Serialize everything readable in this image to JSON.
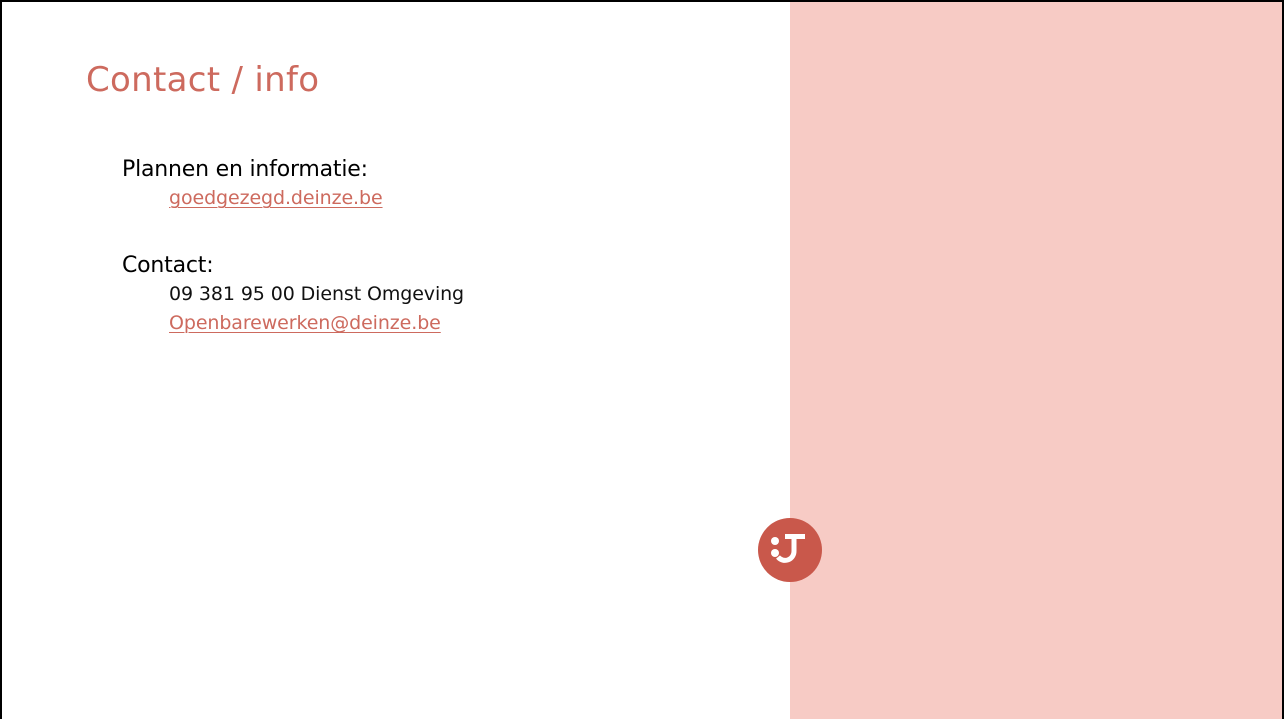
{
  "slide": {
    "title": "Contact / info",
    "info_section": {
      "heading": "Plannen en informatie:",
      "link_text": "goedgezegd.deinze.be"
    },
    "contact_section": {
      "heading": "Contact:",
      "phone_line": "09 381 95 00 Dienst Omgeving",
      "email_text": "Openbarewerken@deinze.be"
    }
  },
  "colors": {
    "accent": "#cd6a5e",
    "panel": "#f7cbc5",
    "logo": "#c9584b"
  },
  "icons": {
    "logo": "smiley-logo-icon"
  }
}
